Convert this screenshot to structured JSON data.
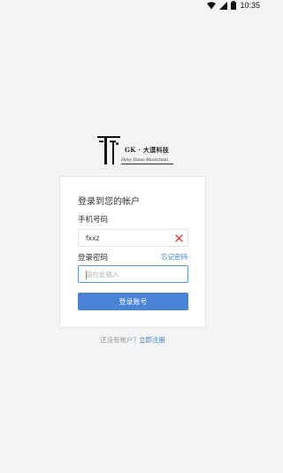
{
  "status_bar": {
    "time": "10:35",
    "icons": [
      "wifi-icon",
      "signal-icon",
      "battery-icon"
    ]
  },
  "logo": {
    "text_top": "GK · 大漠科技",
    "text_bottom": "Dany Damo Blockchain"
  },
  "login": {
    "title": "登录到您的帐户",
    "phone_label": "手机号码",
    "phone_value": "fxxz",
    "clear_icon": "clear-icon",
    "password_label": "登录密码",
    "forgot_password": "忘记密码",
    "password_placeholder": "请在此输入",
    "submit_label": "登录账号"
  },
  "register": {
    "prompt": "还没有帐户?",
    "link": "立即注册"
  },
  "colors": {
    "accent": "#4a82d6",
    "link": "#3b7fd4",
    "clear_icon": "#e53935",
    "background": "#f3f4f6"
  }
}
